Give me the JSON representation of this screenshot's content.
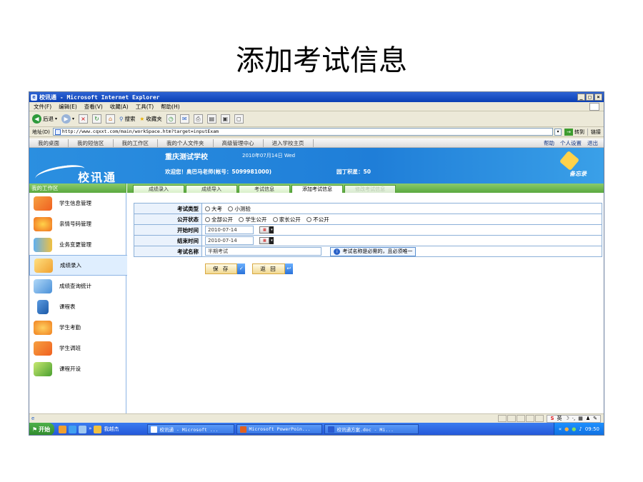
{
  "slide_title": "添加考试信息",
  "window": {
    "title": "校讯通 - Microsoft Internet Explorer"
  },
  "menu": [
    "文件(F)",
    "编辑(E)",
    "查看(V)",
    "收藏(A)",
    "工具(T)",
    "帮助(H)"
  ],
  "toolbar": {
    "back_label": "后退",
    "search_label": "搜索",
    "favorites_label": "收藏夹"
  },
  "address": {
    "label": "地址(D)",
    "url": "http://www.cqxxt.com/main/workSpace.htm?target=inputExam",
    "go_label": "转到",
    "links_label": "链接"
  },
  "topnav": {
    "items": [
      "我的桌面",
      "我的短信区",
      "我的工作区",
      "我的个人文件夹",
      "高级管理中心",
      "进入学校主页"
    ],
    "help": "帮助",
    "settings": "个人设置",
    "logout": "退出"
  },
  "banner": {
    "brand": "校讯通",
    "school": "重庆测试学校",
    "date": "2010年07月14日 Wed",
    "welcome": "欢迎您！奥巴马老师(帐号：5099981000)",
    "garden": "园丁积星：50",
    "tools_label": "备忘录"
  },
  "sidebar": {
    "title": "我的工作区",
    "items": [
      {
        "label": "学生信息管理"
      },
      {
        "label": "亲情号码管理"
      },
      {
        "label": "业务变更管理"
      },
      {
        "label": "成绩录入"
      },
      {
        "label": "成绩查询统计"
      },
      {
        "label": "课程表"
      },
      {
        "label": "学生考勤"
      },
      {
        "label": "学生调班"
      },
      {
        "label": "课程开设"
      }
    ]
  },
  "tabs": [
    "成绩录入",
    "成绩导入",
    "考试信息",
    "添加考试信息",
    "修改考试信息"
  ],
  "form": {
    "exam_type_label": "考试类型",
    "exam_type_options": [
      "大考",
      "小测验"
    ],
    "public_label": "公开状态",
    "public_options": [
      "全部公开",
      "学生公开",
      "家长公开",
      "不公开"
    ],
    "start_label": "开始时间",
    "start_value": "2010-07-14",
    "end_label": "结束时间",
    "end_value": "2010-07-14",
    "name_label": "考试名称",
    "name_value": "半期考试",
    "name_hint": "考试名称是必需的，且必须唯一"
  },
  "actions": {
    "save": "保 存",
    "back": "返 回"
  },
  "ime": {
    "lang": "英"
  },
  "taskbar": {
    "start": "开始",
    "folder": "我越杰",
    "tasks": [
      "校讯通 - Microsoft ...",
      "Microsoft PowerPoin...",
      "校讯通方案.doc - Mi..."
    ],
    "time": "09:50"
  }
}
